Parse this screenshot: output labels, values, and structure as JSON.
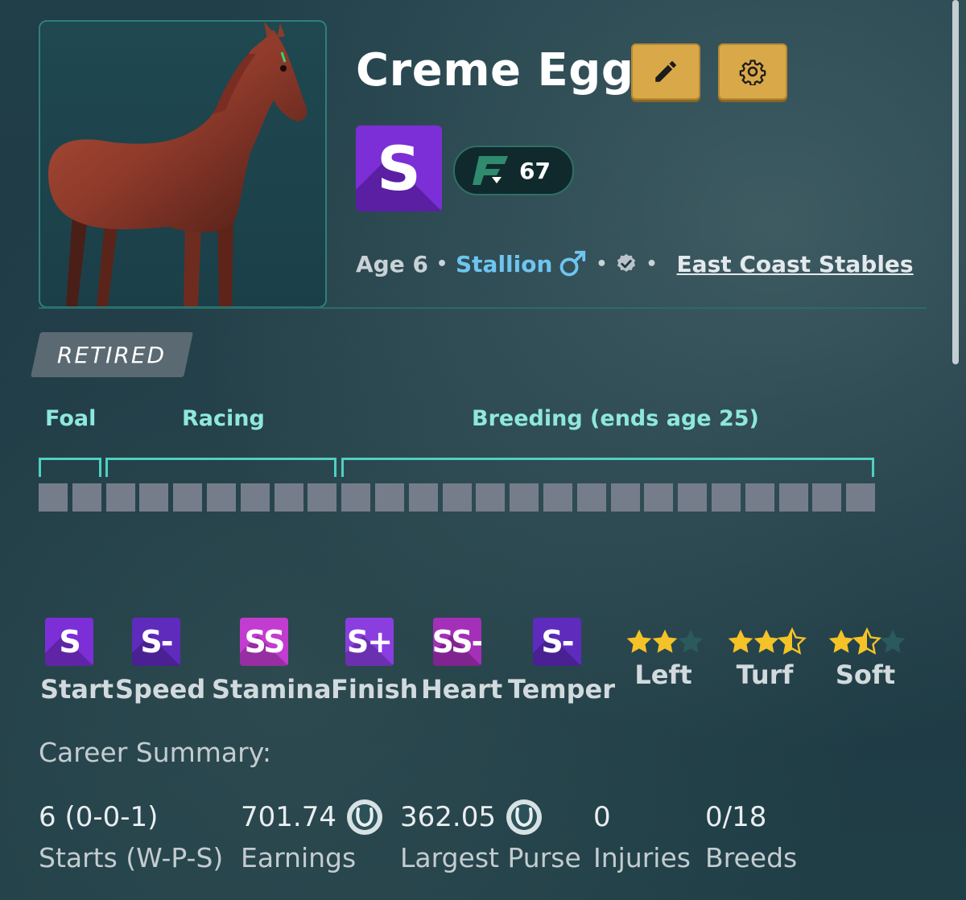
{
  "horse": {
    "name": "Creme Egg",
    "grade": "S",
    "rating": "67",
    "age": "Age 6",
    "sex": "Stallion",
    "owner": "East Coast Stables",
    "status": "RETIRED"
  },
  "lifecycle": {
    "phases": [
      {
        "label": "Foal"
      },
      {
        "label": "Racing"
      },
      {
        "label": "Breeding (ends age 25)"
      }
    ],
    "cells_total": 25,
    "cells_filled": 0
  },
  "stats": [
    {
      "grade": "S",
      "label": "Start"
    },
    {
      "grade": "S-",
      "label": "Speed"
    },
    {
      "grade": "SS",
      "label": "Stamina"
    },
    {
      "grade": "S+",
      "label": "Finish"
    },
    {
      "grade": "SS-",
      "label": "Heart"
    },
    {
      "grade": "S-",
      "label": "Temper"
    }
  ],
  "preferences": [
    {
      "label": "Left",
      "stars": 2,
      "max": 3
    },
    {
      "label": "Turf",
      "stars": 2.5,
      "max": 3
    },
    {
      "label": "Soft",
      "stars": 1.5,
      "max": 3
    }
  ],
  "career": {
    "title": "Career Summary:",
    "starts": {
      "value": "6 (0-0-1)",
      "label": "Starts (W-P-S)"
    },
    "earnings": {
      "value": "701.74",
      "label": "Earnings"
    },
    "largest_purse": {
      "value": "362.05",
      "label": "Largest Purse"
    },
    "injuries": {
      "value": "0",
      "label": "Injuries"
    },
    "breeds": {
      "value": "0/18",
      "label": "Breeds"
    }
  },
  "icons": {
    "edit": "pencil-icon",
    "settings": "gear-icon",
    "sex": "male-icon",
    "verified": "verified-badge-icon",
    "currency": "horseshoe-coin-icon",
    "rating": "f-rating-logo-icon"
  },
  "colors": {
    "accent_teal": "#4fd0c2",
    "gold_button": "#d9a848",
    "grade_purple": "#7c2fd6",
    "grade_magenta": "#b23cc9",
    "stallion_blue": "#6ec6f0",
    "star_gold": "#f5c327",
    "star_empty": "#2b5a5c"
  }
}
